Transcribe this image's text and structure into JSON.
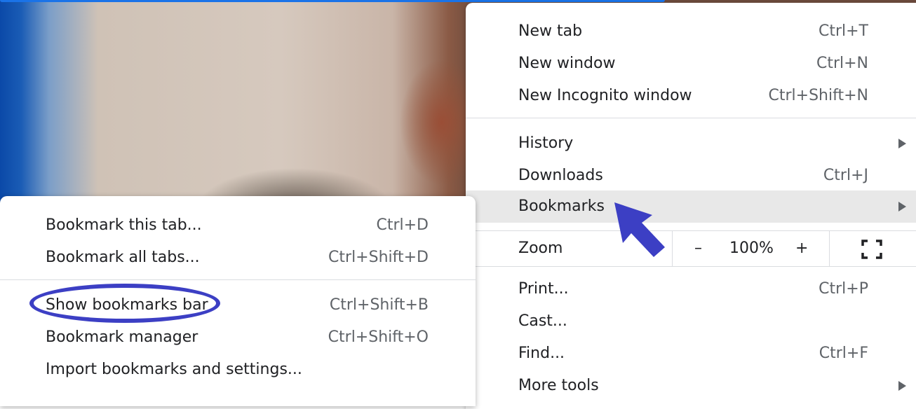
{
  "main_menu": {
    "items_group1": [
      {
        "label": "New tab",
        "shortcut": "Ctrl+T"
      },
      {
        "label": "New window",
        "shortcut": "Ctrl+N"
      },
      {
        "label": "New Incognito window",
        "shortcut": "Ctrl+Shift+N"
      }
    ],
    "items_group2": [
      {
        "label": "History",
        "shortcut": ""
      },
      {
        "label": "Downloads",
        "shortcut": "Ctrl+J"
      },
      {
        "label": "Bookmarks",
        "shortcut": ""
      }
    ],
    "zoom": {
      "label": "Zoom",
      "minus": "–",
      "value": "100%",
      "plus": "+"
    },
    "items_group3": [
      {
        "label": "Print...",
        "shortcut": "Ctrl+P"
      },
      {
        "label": "Cast...",
        "shortcut": ""
      },
      {
        "label": "Find...",
        "shortcut": "Ctrl+F"
      },
      {
        "label": "More tools",
        "shortcut": ""
      }
    ]
  },
  "bookmarks_submenu": {
    "items_group1": [
      {
        "label": "Bookmark this tab...",
        "shortcut": "Ctrl+D"
      },
      {
        "label": "Bookmark all tabs...",
        "shortcut": "Ctrl+Shift+D"
      }
    ],
    "items_group2": [
      {
        "label": "Show bookmarks bar",
        "shortcut": "Ctrl+Shift+B"
      },
      {
        "label": "Bookmark manager",
        "shortcut": "Ctrl+Shift+O"
      },
      {
        "label": "Import bookmarks and settings...",
        "shortcut": ""
      }
    ]
  },
  "icons": {
    "submenu_arrow": "chevron-right-icon",
    "fullscreen": "fullscreen-icon",
    "annotation_arrow": "pointer-arrow-icon"
  },
  "colors": {
    "highlight": "#e8e8e8",
    "annotation": "#3c3fc4",
    "address_bar": "#1a73e8"
  }
}
